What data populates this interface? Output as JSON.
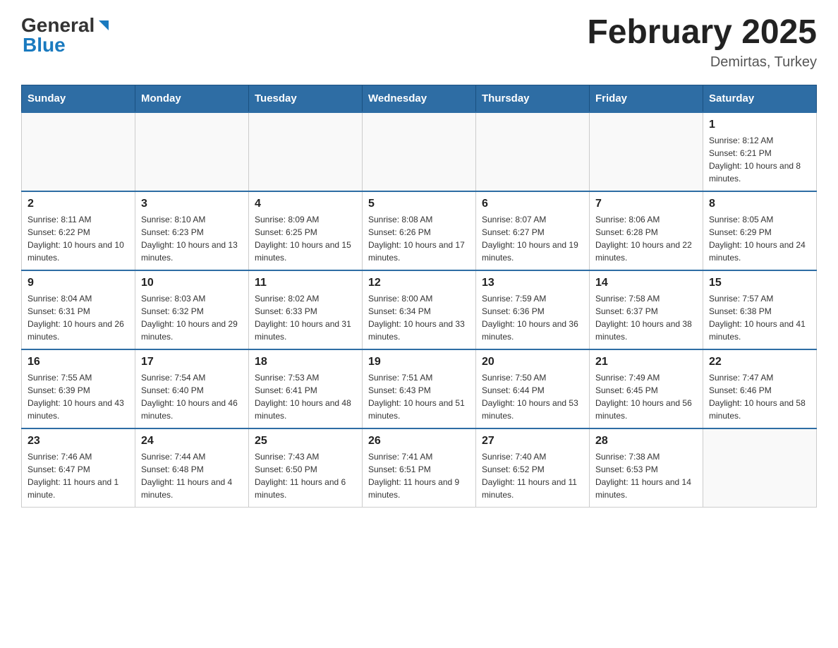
{
  "header": {
    "logo_general": "General",
    "logo_blue": "Blue",
    "month_title": "February 2025",
    "location": "Demirtas, Turkey"
  },
  "days_of_week": [
    "Sunday",
    "Monday",
    "Tuesday",
    "Wednesday",
    "Thursday",
    "Friday",
    "Saturday"
  ],
  "weeks": [
    [
      {
        "day": "",
        "info": ""
      },
      {
        "day": "",
        "info": ""
      },
      {
        "day": "",
        "info": ""
      },
      {
        "day": "",
        "info": ""
      },
      {
        "day": "",
        "info": ""
      },
      {
        "day": "",
        "info": ""
      },
      {
        "day": "1",
        "info": "Sunrise: 8:12 AM\nSunset: 6:21 PM\nDaylight: 10 hours and 8 minutes."
      }
    ],
    [
      {
        "day": "2",
        "info": "Sunrise: 8:11 AM\nSunset: 6:22 PM\nDaylight: 10 hours and 10 minutes."
      },
      {
        "day": "3",
        "info": "Sunrise: 8:10 AM\nSunset: 6:23 PM\nDaylight: 10 hours and 13 minutes."
      },
      {
        "day": "4",
        "info": "Sunrise: 8:09 AM\nSunset: 6:25 PM\nDaylight: 10 hours and 15 minutes."
      },
      {
        "day": "5",
        "info": "Sunrise: 8:08 AM\nSunset: 6:26 PM\nDaylight: 10 hours and 17 minutes."
      },
      {
        "day": "6",
        "info": "Sunrise: 8:07 AM\nSunset: 6:27 PM\nDaylight: 10 hours and 19 minutes."
      },
      {
        "day": "7",
        "info": "Sunrise: 8:06 AM\nSunset: 6:28 PM\nDaylight: 10 hours and 22 minutes."
      },
      {
        "day": "8",
        "info": "Sunrise: 8:05 AM\nSunset: 6:29 PM\nDaylight: 10 hours and 24 minutes."
      }
    ],
    [
      {
        "day": "9",
        "info": "Sunrise: 8:04 AM\nSunset: 6:31 PM\nDaylight: 10 hours and 26 minutes."
      },
      {
        "day": "10",
        "info": "Sunrise: 8:03 AM\nSunset: 6:32 PM\nDaylight: 10 hours and 29 minutes."
      },
      {
        "day": "11",
        "info": "Sunrise: 8:02 AM\nSunset: 6:33 PM\nDaylight: 10 hours and 31 minutes."
      },
      {
        "day": "12",
        "info": "Sunrise: 8:00 AM\nSunset: 6:34 PM\nDaylight: 10 hours and 33 minutes."
      },
      {
        "day": "13",
        "info": "Sunrise: 7:59 AM\nSunset: 6:36 PM\nDaylight: 10 hours and 36 minutes."
      },
      {
        "day": "14",
        "info": "Sunrise: 7:58 AM\nSunset: 6:37 PM\nDaylight: 10 hours and 38 minutes."
      },
      {
        "day": "15",
        "info": "Sunrise: 7:57 AM\nSunset: 6:38 PM\nDaylight: 10 hours and 41 minutes."
      }
    ],
    [
      {
        "day": "16",
        "info": "Sunrise: 7:55 AM\nSunset: 6:39 PM\nDaylight: 10 hours and 43 minutes."
      },
      {
        "day": "17",
        "info": "Sunrise: 7:54 AM\nSunset: 6:40 PM\nDaylight: 10 hours and 46 minutes."
      },
      {
        "day": "18",
        "info": "Sunrise: 7:53 AM\nSunset: 6:41 PM\nDaylight: 10 hours and 48 minutes."
      },
      {
        "day": "19",
        "info": "Sunrise: 7:51 AM\nSunset: 6:43 PM\nDaylight: 10 hours and 51 minutes."
      },
      {
        "day": "20",
        "info": "Sunrise: 7:50 AM\nSunset: 6:44 PM\nDaylight: 10 hours and 53 minutes."
      },
      {
        "day": "21",
        "info": "Sunrise: 7:49 AM\nSunset: 6:45 PM\nDaylight: 10 hours and 56 minutes."
      },
      {
        "day": "22",
        "info": "Sunrise: 7:47 AM\nSunset: 6:46 PM\nDaylight: 10 hours and 58 minutes."
      }
    ],
    [
      {
        "day": "23",
        "info": "Sunrise: 7:46 AM\nSunset: 6:47 PM\nDaylight: 11 hours and 1 minute."
      },
      {
        "day": "24",
        "info": "Sunrise: 7:44 AM\nSunset: 6:48 PM\nDaylight: 11 hours and 4 minutes."
      },
      {
        "day": "25",
        "info": "Sunrise: 7:43 AM\nSunset: 6:50 PM\nDaylight: 11 hours and 6 minutes."
      },
      {
        "day": "26",
        "info": "Sunrise: 7:41 AM\nSunset: 6:51 PM\nDaylight: 11 hours and 9 minutes."
      },
      {
        "day": "27",
        "info": "Sunrise: 7:40 AM\nSunset: 6:52 PM\nDaylight: 11 hours and 11 minutes."
      },
      {
        "day": "28",
        "info": "Sunrise: 7:38 AM\nSunset: 6:53 PM\nDaylight: 11 hours and 14 minutes."
      },
      {
        "day": "",
        "info": ""
      }
    ]
  ]
}
